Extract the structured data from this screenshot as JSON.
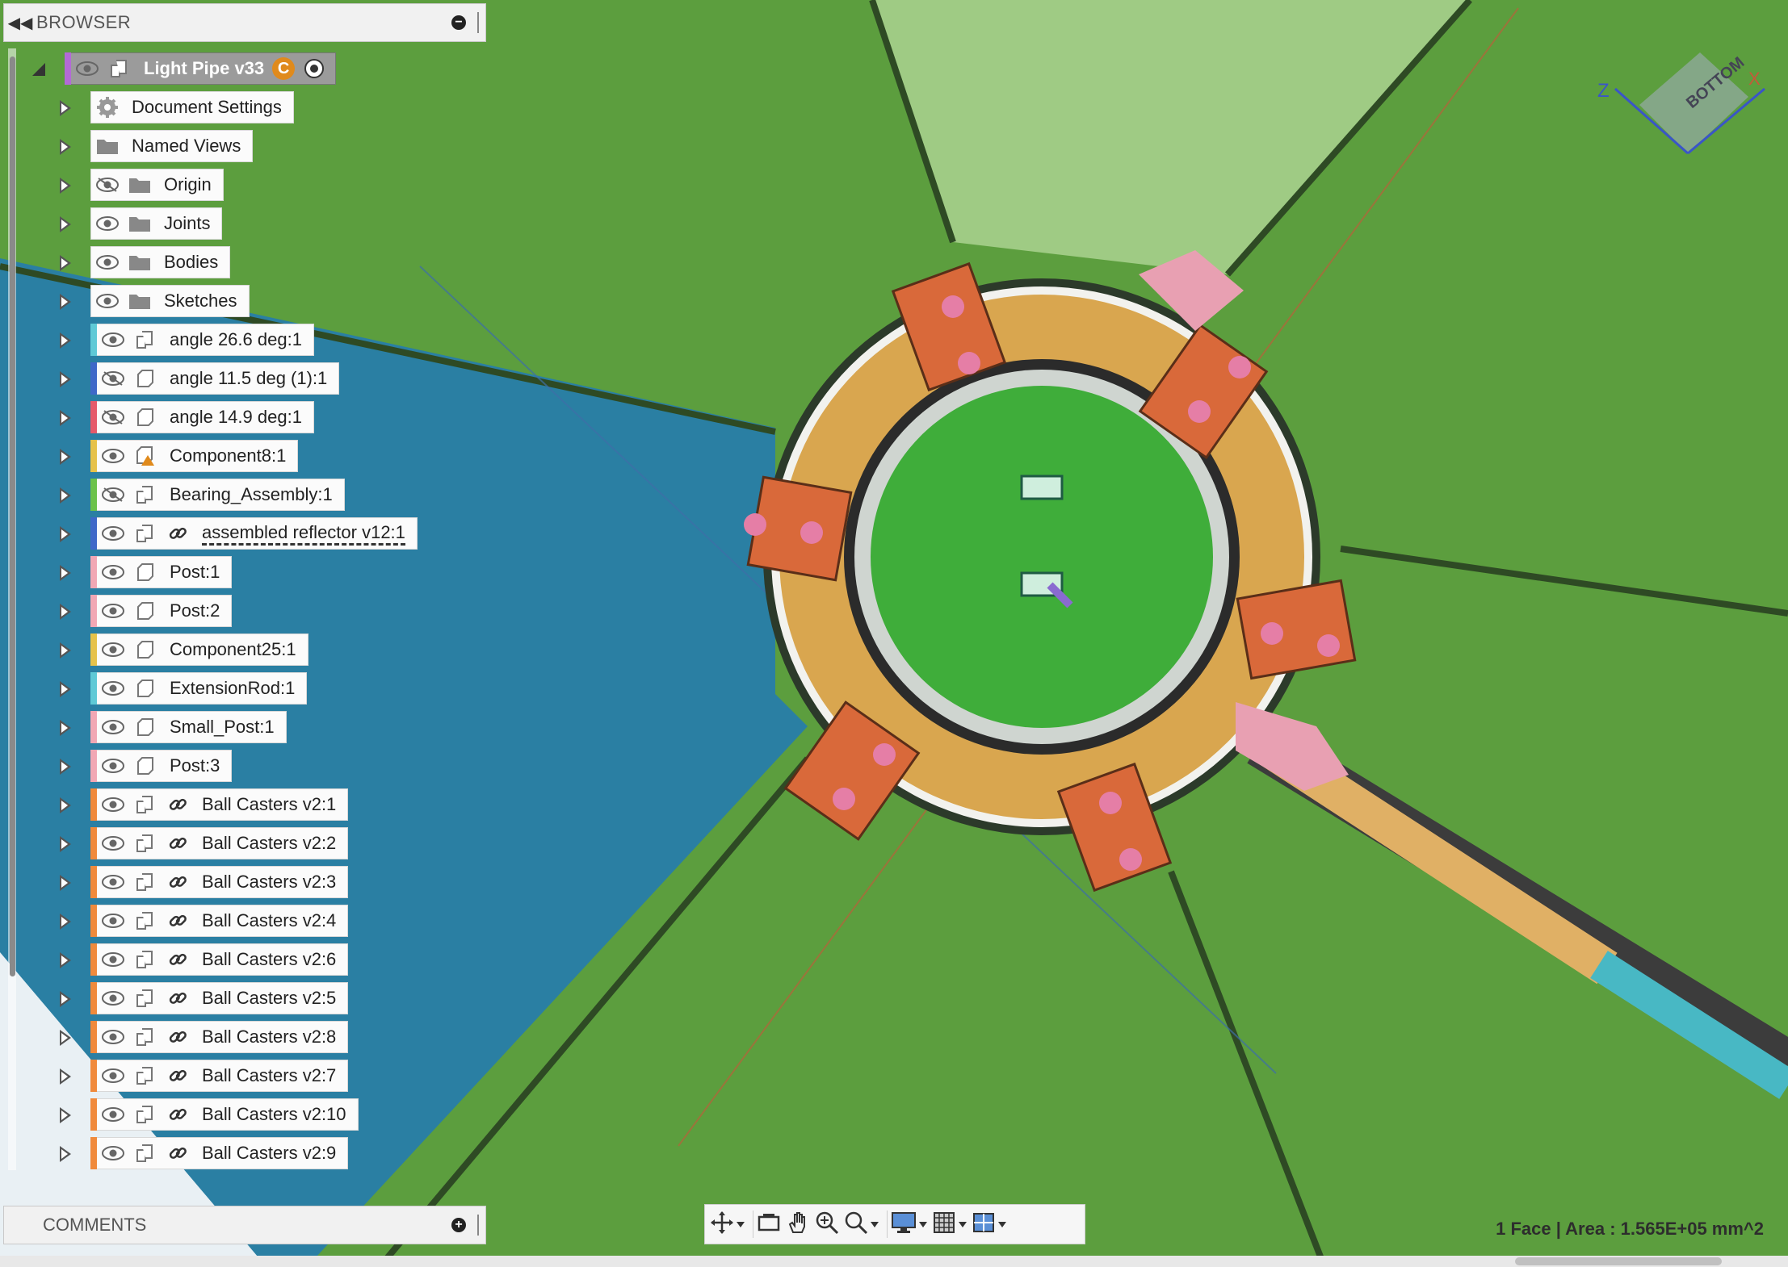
{
  "browser": {
    "title": "BROWSER",
    "root": {
      "label": "Light Pipe v33",
      "badge": "C"
    },
    "items": [
      {
        "label": "Document Settings",
        "icon": "gear-icon",
        "eye": "none",
        "color": ""
      },
      {
        "label": "Named Views",
        "icon": "folder-icon",
        "eye": "none",
        "color": ""
      },
      {
        "label": "Origin",
        "icon": "folder-icon",
        "eye": "hidden",
        "color": ""
      },
      {
        "label": "Joints",
        "icon": "folder-icon",
        "eye": "visible",
        "color": ""
      },
      {
        "label": "Bodies",
        "icon": "folder-icon",
        "eye": "visible",
        "color": ""
      },
      {
        "label": "Sketches",
        "icon": "folder-icon",
        "eye": "visible",
        "color": ""
      },
      {
        "label": "angle 26.6 deg:1",
        "icon": "component-icon",
        "eye": "visible",
        "color": "#5fc9d6"
      },
      {
        "label": "angle 11.5 deg (1):1",
        "icon": "body-icon",
        "eye": "hidden",
        "color": "#3f68c8"
      },
      {
        "label": "angle 14.9 deg:1",
        "icon": "body-icon",
        "eye": "hidden",
        "color": "#e55a6a"
      },
      {
        "label": "Component8:1",
        "icon": "component-warning-icon",
        "eye": "visible",
        "color": "#e6c24a"
      },
      {
        "label": "Bearing_Assembly:1",
        "icon": "component-icon",
        "eye": "hidden",
        "color": "#6bc24a"
      },
      {
        "label": "assembled reflector v12:1",
        "icon": "component-icon",
        "eye": "visible",
        "color": "#3f68c8",
        "link": true,
        "dashed": true
      },
      {
        "label": "Post:1",
        "icon": "body-icon",
        "eye": "visible",
        "color": "#f1a7b4"
      },
      {
        "label": "Post:2",
        "icon": "body-icon",
        "eye": "visible",
        "color": "#f1a7b4"
      },
      {
        "label": "Component25:1",
        "icon": "body-icon",
        "eye": "visible",
        "color": "#e6c24a"
      },
      {
        "label": "ExtensionRod:1",
        "icon": "body-icon",
        "eye": "visible",
        "color": "#5fc9d6"
      },
      {
        "label": "Small_Post:1",
        "icon": "body-icon",
        "eye": "visible",
        "color": "#f1a7b4"
      },
      {
        "label": "Post:3",
        "icon": "body-icon",
        "eye": "visible",
        "color": "#f1a7b4"
      },
      {
        "label": "Ball Casters v2:1",
        "icon": "component-icon",
        "eye": "visible",
        "color": "#f08a3c",
        "link": true
      },
      {
        "label": "Ball Casters v2:2",
        "icon": "component-icon",
        "eye": "visible",
        "color": "#f08a3c",
        "link": true
      },
      {
        "label": "Ball Casters v2:3",
        "icon": "component-icon",
        "eye": "visible",
        "color": "#f08a3c",
        "link": true
      },
      {
        "label": "Ball Casters v2:4",
        "icon": "component-icon",
        "eye": "visible",
        "color": "#f08a3c",
        "link": true
      },
      {
        "label": "Ball Casters v2:6",
        "icon": "component-icon",
        "eye": "visible",
        "color": "#f08a3c",
        "link": true
      },
      {
        "label": "Ball Casters v2:5",
        "icon": "component-icon",
        "eye": "visible",
        "color": "#f08a3c",
        "link": true
      },
      {
        "label": "Ball Casters v2:8",
        "icon": "component-icon",
        "eye": "visible",
        "color": "#f08a3c",
        "link": true
      },
      {
        "label": "Ball Casters v2:7",
        "icon": "component-icon",
        "eye": "visible",
        "color": "#f08a3c",
        "link": true
      },
      {
        "label": "Ball Casters v2:10",
        "icon": "component-icon",
        "eye": "visible",
        "color": "#f08a3c",
        "link": true
      },
      {
        "label": "Ball Casters v2:9",
        "icon": "component-icon",
        "eye": "visible",
        "color": "#f08a3c",
        "link": true
      }
    ]
  },
  "comments": {
    "title": "COMMENTS"
  },
  "status": {
    "selection": "1 Face | Area : 1.565E+05 mm^2"
  },
  "viewcube": {
    "face": "BOTTOM",
    "axes": [
      "Z",
      "X"
    ]
  },
  "navbar": {
    "tools": [
      "orbit-icon",
      "look-at-icon",
      "pan-icon",
      "zoom-icon",
      "fit-icon",
      "display-settings-icon",
      "grid-icon",
      "viewports-icon"
    ]
  }
}
